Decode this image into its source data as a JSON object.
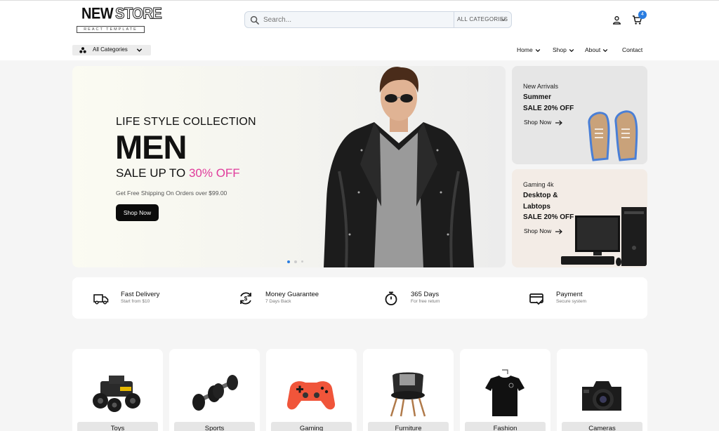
{
  "brand": {
    "name_part1": "NEW",
    "name_part2": "STORE",
    "tagline": "REACT TEMPLATE"
  },
  "search": {
    "placeholder": "Search...",
    "category": "ALL CATEGORIES"
  },
  "cart": {
    "count": "4"
  },
  "category_menu": {
    "label": "All Categories"
  },
  "nav": [
    {
      "label": "Home"
    },
    {
      "label": "Shop"
    },
    {
      "label": "About"
    },
    {
      "label": "Contact"
    }
  ],
  "hero": {
    "subtitle": "LIFE STYLE COLLECTION",
    "title": "MEN",
    "sale_prefix": "SALE UP TO ",
    "sale_accent": "30% OFF",
    "shipping": "Get Free Shipping On Orders over $99.00",
    "button": "Shop Now",
    "slides": 3,
    "active_slide": 1
  },
  "promos": [
    {
      "tag": "New Arrivals",
      "lines": [
        "Summer",
        "SALE 20% OFF"
      ],
      "link": "Shop Now"
    },
    {
      "tag": "Gaming 4k",
      "lines": [
        "Desktop &",
        "Labtops",
        "SALE 20% OFF"
      ],
      "link": "Shop Now"
    }
  ],
  "services": [
    {
      "title": "Fast Delivery",
      "subtitle": "Start from $10",
      "icon": "truck-icon"
    },
    {
      "title": "Money Guarantee",
      "subtitle": "7 Days Back",
      "icon": "money-back-icon"
    },
    {
      "title": "365 Days",
      "subtitle": "For free return",
      "icon": "stopwatch-icon"
    },
    {
      "title": "Payment",
      "subtitle": "Secure system",
      "icon": "credit-card-icon"
    }
  ],
  "categories": [
    {
      "label": "Toys",
      "icon": "toy-car-icon"
    },
    {
      "label": "Sports",
      "icon": "dumbbell-icon"
    },
    {
      "label": "Gaming",
      "icon": "gamepad-icon"
    },
    {
      "label": "Furniture",
      "icon": "chair-icon"
    },
    {
      "label": "Fashion",
      "icon": "tshirt-icon"
    },
    {
      "label": "Cameras",
      "icon": "camera-icon"
    }
  ],
  "colors": {
    "accent": "#e03b9b",
    "badge": "#2a7de1",
    "dark": "#0b0b0b"
  }
}
